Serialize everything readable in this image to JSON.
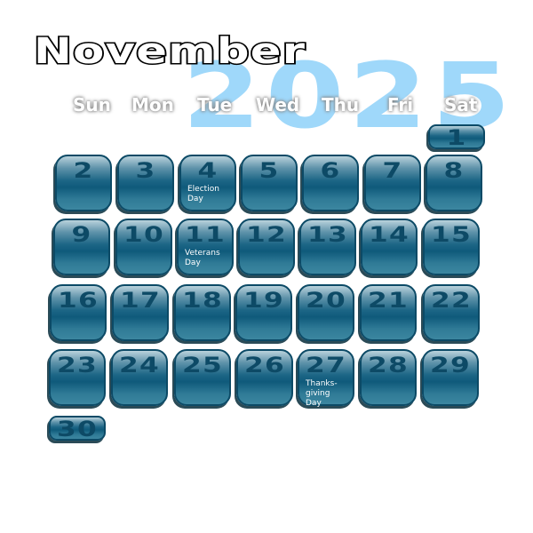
{
  "month": "November",
  "year": "2025",
  "weekdays": [
    "Sun",
    "Mon",
    "Tue",
    "Wed",
    "Thu",
    "Fri",
    "Sat"
  ],
  "first_weekday": 6,
  "days_in_month": 30,
  "days": [
    "1",
    "2",
    "3",
    "4",
    "5",
    "6",
    "7",
    "8",
    "9",
    "10",
    "11",
    "12",
    "13",
    "14",
    "15",
    "16",
    "17",
    "18",
    "19",
    "20",
    "21",
    "22",
    "23",
    "24",
    "25",
    "26",
    "27",
    "28",
    "29",
    "30"
  ],
  "holidays": {
    "4": "Election Day",
    "11": "Veterans Day",
    "27": "Thanks- giving Day"
  },
  "colors": {
    "tile": "#1d6686",
    "number": "#0d4a66",
    "year": "#9fd8fa"
  }
}
